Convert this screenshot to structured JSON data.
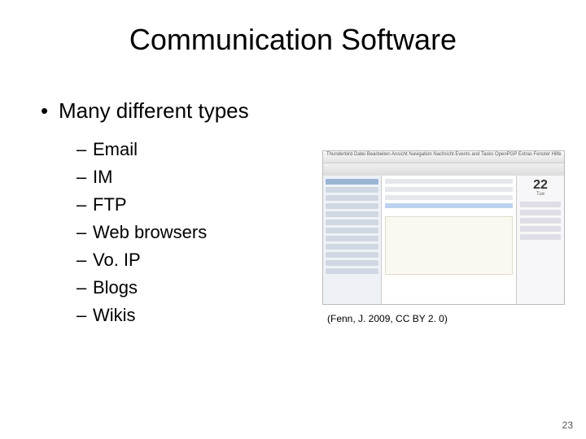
{
  "title": "Communication Software",
  "bullet_main": "Many different types",
  "sub_items": [
    "Email",
    "IM",
    "FTP",
    "Web browsers",
    "Vo. IP",
    "Blogs",
    "Wikis"
  ],
  "figure": {
    "menubar_text": "Thunderbird   Datei   Bearbeiten   Ansicht   Navigation   Nachricht   Events and Tasks   OpenPGP   Extras   Fenster   Hilfe",
    "cal_day_num": "22",
    "cal_day_label": "Tue",
    "caption": "(Fenn, J. 2009, CC BY 2. 0)"
  },
  "page_number": "23"
}
